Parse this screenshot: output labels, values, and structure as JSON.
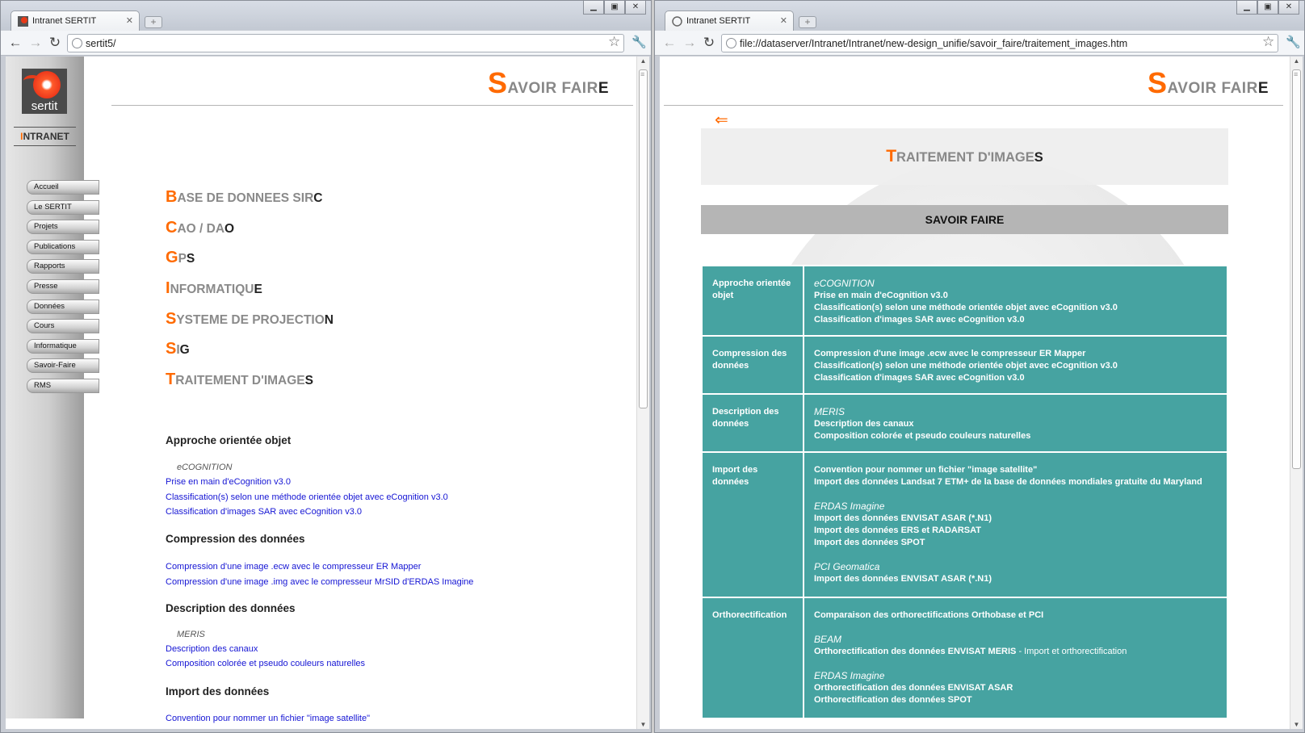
{
  "left_window": {
    "tab_title": "Intranet SERTIT",
    "url": "sertit5/",
    "page_title": {
      "first": "S",
      "mid": "AVOIR FAIR",
      "last": "E"
    },
    "logo_text": "sertit",
    "intranet": {
      "first": "I",
      "rest": "NTRANET"
    },
    "menu": [
      "Accueil",
      "Le SERTIT",
      "Projets",
      "Publications",
      "Rapports",
      "Presse",
      "Données",
      "Cours",
      "Informatique",
      "Savoir-Faire",
      "RMS"
    ],
    "categories": [
      {
        "first": "B",
        "mid": "ASE DE DONNEES SIR",
        "last": "C"
      },
      {
        "first": "C",
        "mid": "AO / DA",
        "last": "O"
      },
      {
        "first": "G",
        "mid": "P",
        "last": "S"
      },
      {
        "first": "I",
        "mid": "NFORMATIQU",
        "last": "E"
      },
      {
        "first": "S",
        "mid": "YSTEME DE PROJECTIO",
        "last": "N"
      },
      {
        "first": "S",
        "mid": "I",
        "last": "G"
      },
      {
        "first": "T",
        "mid": "RAITEMENT D'IMAGE",
        "last": "S"
      }
    ],
    "sections": {
      "s1": {
        "title": "Approche orientée objet",
        "software": "eCOGNITION",
        "links": [
          "Prise en main d'eCognition v3.0",
          "Classification(s) selon une méthode orientée objet avec eCognition v3.0",
          "Classification d'images SAR avec eCognition v3.0"
        ]
      },
      "s2": {
        "title": "Compression des données",
        "links": [
          "Compression d'une image .ecw avec le compresseur ER Mapper",
          "Compression d'une image .img avec le compresseur MrSID d'ERDAS Imagine"
        ]
      },
      "s3": {
        "title": "Description des données",
        "software": "MERIS",
        "links": [
          "Description des canaux",
          "Composition colorée et pseudo couleurs naturelles"
        ]
      },
      "s4": {
        "title": "Import des données",
        "links": [
          "Convention pour nommer un fichier \"image satellite\""
        ]
      }
    }
  },
  "right_window": {
    "tab_title": "Intranet SERTIT",
    "url": "file://dataserver/Intranet/Intranet/new-design_unifie/savoir_faire/traitement_images.htm",
    "page_title": {
      "first": "S",
      "mid": "AVOIR FAIR",
      "last": "E"
    },
    "back_arrow": "⇐",
    "banner": {
      "first": "T",
      "mid": "RAITEMENT D'IMAGE",
      "last": "S"
    },
    "bar_title": "SAVOIR FAIRE",
    "rows": {
      "r1": {
        "label": "Approche orientée objet",
        "sw1": "eCOGNITION",
        "l1": "Prise en main d'eCognition v3.0",
        "l2": "Classification(s) selon une méthode orientée objet avec eCognition v3.0",
        "l3": "Classification d'images SAR avec eCognition v3.0"
      },
      "r2": {
        "label": "Compression des données",
        "l1": "Compression d'une image .ecw avec le compresseur ER Mapper",
        "l2": "Classification(s) selon une méthode orientée objet avec eCognition v3.0",
        "l3": "Classification d'images SAR avec eCognition v3.0"
      },
      "r3": {
        "label": "Description des données",
        "sw1": "MERIS",
        "l1": "Description des canaux",
        "l2": "Composition colorée et pseudo couleurs naturelles"
      },
      "r4": {
        "label": "Import des données",
        "l1": "Convention pour nommer un fichier \"image satellite\"",
        "l2": "Import des données Landsat 7 ETM+ de la base de données mondiales gratuite du Maryland",
        "sw2": "ERDAS Imagine",
        "l3": "Import des données ENVISAT ASAR (*.N1)",
        "l4": "Import des données ERS et RADARSAT",
        "l5": "Import des données SPOT",
        "sw3": "PCI Geomatica",
        "l6": "Import des données ENVISAT ASAR (*.N1)"
      },
      "r5": {
        "label": "Orthorectification",
        "l1": "Comparaison des orthorectifications Orthobase et PCI",
        "sw2": "BEAM",
        "l2": "Orthorectification des données ENVISAT MERIS",
        "l2b": " - Import et orthorectification",
        "sw3": "ERDAS Imagine",
        "l3": "Orthorectification des données ENVISAT ASAR",
        "l4": "Orthorectification des données SPOT"
      }
    }
  },
  "colors": {
    "accent": "#ff6a00",
    "link": "#1515d4",
    "teal": "#46a3a1"
  }
}
